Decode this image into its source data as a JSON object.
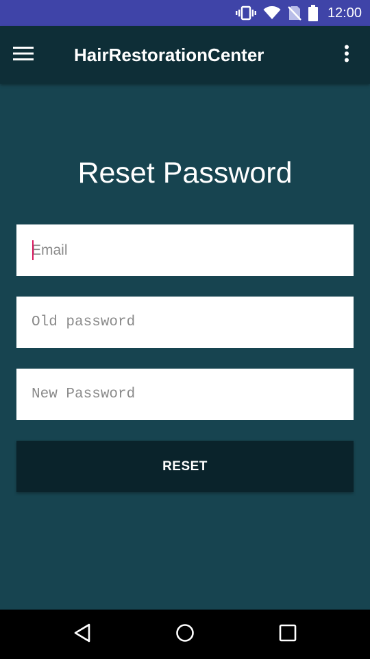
{
  "status_bar": {
    "time": "12:00",
    "icons": [
      "vibrate-icon",
      "wifi-icon",
      "no-sim-icon",
      "battery-icon"
    ]
  },
  "app_bar": {
    "title": "HairRestorationCenter",
    "menu_icon": "hamburger-menu-icon",
    "overflow_icon": "more-vert-icon"
  },
  "form": {
    "heading": "Reset Password",
    "email": {
      "placeholder": "Email",
      "value": ""
    },
    "old_password": {
      "placeholder": "Old password",
      "value": ""
    },
    "new_password": {
      "placeholder": "New Password",
      "value": ""
    },
    "reset_label": "RESET"
  },
  "nav_bar": {
    "icons": [
      "back-icon",
      "home-icon",
      "recents-icon"
    ]
  },
  "colors": {
    "status_bar": "#3f44a8",
    "app_bar": "#0e2e37",
    "background": "#174450",
    "button": "#0a232b",
    "cursor": "#d81b60",
    "nav_bar": "#000000"
  }
}
